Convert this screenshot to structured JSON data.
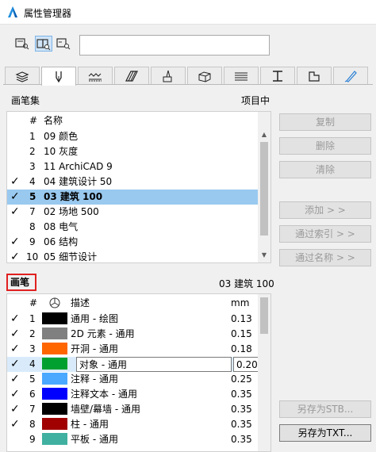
{
  "window": {
    "title": "属性管理器"
  },
  "search": {
    "value": ""
  },
  "penset_section": {
    "label": "画笔集",
    "right_label": "项目中"
  },
  "penset_list": {
    "columns": {
      "num": "#",
      "name": "名称"
    },
    "rows": [
      {
        "checked": false,
        "num": "1",
        "name": "09 颜色",
        "selected": false
      },
      {
        "checked": false,
        "num": "2",
        "name": "10 灰度",
        "selected": false
      },
      {
        "checked": false,
        "num": "3",
        "name": "11 ArchiCAD 9",
        "selected": false
      },
      {
        "checked": true,
        "num": "4",
        "name": "04 建筑设计 50",
        "selected": false
      },
      {
        "checked": true,
        "num": "5",
        "name": "03 建筑 100",
        "selected": true
      },
      {
        "checked": true,
        "num": "7",
        "name": "02 场地 500",
        "selected": false
      },
      {
        "checked": false,
        "num": "8",
        "name": "08 电气",
        "selected": false
      },
      {
        "checked": true,
        "num": "9",
        "name": "06 结构",
        "selected": false
      },
      {
        "checked": true,
        "num": "10",
        "name": "05 细节设计",
        "selected": false
      }
    ]
  },
  "side_buttons": {
    "copy": "复制",
    "delete": "删除",
    "clear": "清除",
    "add": "添加 > >",
    "by_index": "通过索引 > >",
    "by_name": "通过名称 > >",
    "save_stb": "另存为STB...",
    "save_txt": "另存为TXT..."
  },
  "pen_section": {
    "label": "画笔",
    "right_label": "03 建筑 100"
  },
  "pen_list": {
    "columns": {
      "num": "#",
      "desc": "描述",
      "mm": "mm"
    },
    "rows": [
      {
        "checked": true,
        "num": "1",
        "color": "#000000",
        "desc": "通用 - 绘图",
        "mm": "0.13"
      },
      {
        "checked": true,
        "num": "2",
        "color": "#808080",
        "desc": "2D 元素 - 通用",
        "mm": "0.15"
      },
      {
        "checked": true,
        "num": "3",
        "color": "#ff6600",
        "desc": "开洞 - 通用",
        "mm": "0.18"
      },
      {
        "checked": true,
        "num": "4",
        "color": "#00a030",
        "desc": "对象 - 通用",
        "mm": "0.20",
        "editing": true
      },
      {
        "checked": true,
        "num": "5",
        "color": "#4aa8ff",
        "desc": "注释 - 通用",
        "mm": "0.25"
      },
      {
        "checked": true,
        "num": "6",
        "color": "#0000ff",
        "desc": "注释文本  - 通用",
        "mm": "0.35"
      },
      {
        "checked": true,
        "num": "7",
        "color": "#000000",
        "desc": "墙壁/幕墙 - 通用",
        "mm": "0.35"
      },
      {
        "checked": true,
        "num": "8",
        "color": "#a00000",
        "desc": "柱 - 通用",
        "mm": "0.35"
      },
      {
        "checked": false,
        "num": "9",
        "color": "#40b0a0",
        "desc": "平板 - 通用",
        "mm": "0.35"
      }
    ]
  },
  "colors": {
    "selection": "#99c9ef",
    "accent": "#7db4e8",
    "highlight_border": "#e02020"
  }
}
